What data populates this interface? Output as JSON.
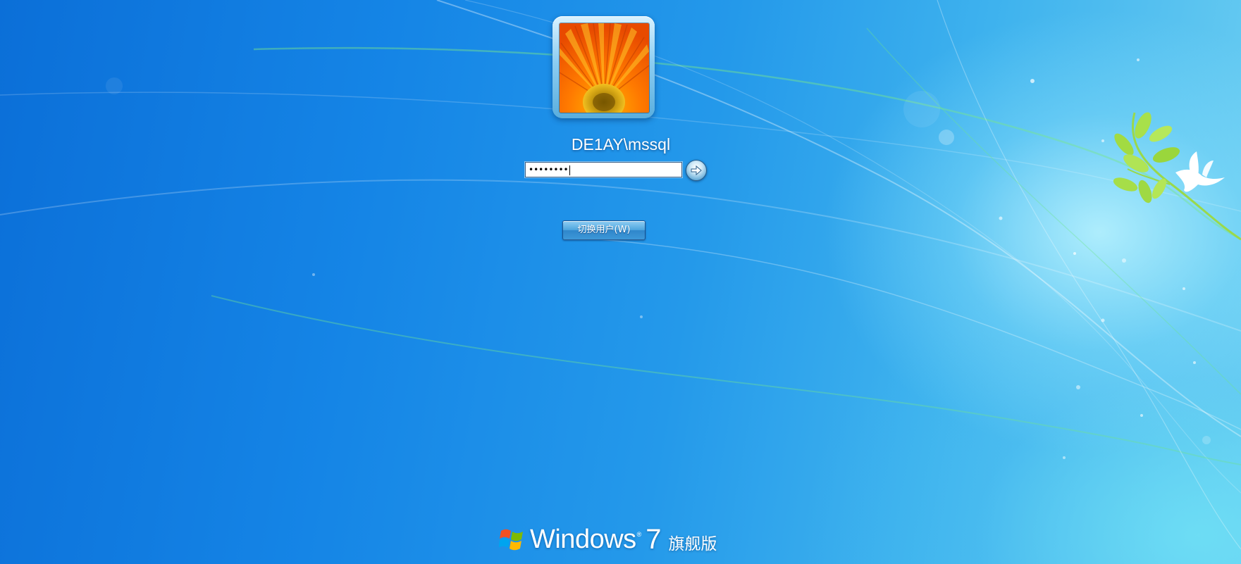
{
  "login": {
    "username": "DE1AY\\mssql",
    "password_masked": "••••••••",
    "submit_icon": "arrow-right-icon",
    "switch_user_label": "切换用户(W)",
    "avatar_icon": "flower-avatar-icon"
  },
  "branding": {
    "logo_icon": "windows-flag-icon",
    "product_name": "Windows",
    "registered_mark": "®",
    "version": "7",
    "edition": "旗舰版"
  },
  "colors": {
    "background_deep": "#0b6fd8",
    "background_light": "#6fd0f2",
    "button_blue": "#3d98d8",
    "text": "#ffffff"
  }
}
